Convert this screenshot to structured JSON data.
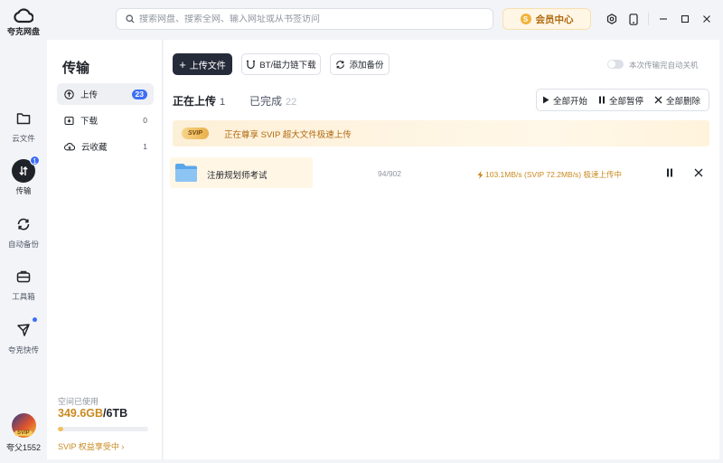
{
  "app": {
    "name": "夸克网盘"
  },
  "rail": {
    "items": [
      {
        "label": "云文件",
        "icon": "folder-icon"
      },
      {
        "label": "传输",
        "icon": "transfer-icon",
        "badge": "1"
      },
      {
        "label": "自动备份",
        "icon": "backup-icon"
      },
      {
        "label": "工具箱",
        "icon": "toolbox-icon"
      },
      {
        "label": "夸克快传",
        "icon": "send-icon"
      }
    ],
    "user": {
      "name": "夸父1552",
      "badge": "SVIP"
    }
  },
  "topbar": {
    "search_placeholder": "搜索网盘、搜索全网、输入网址或从书签访问",
    "vip_label": "会员中心",
    "vip_coin": "S",
    "icons": [
      "settings-icon",
      "phone-icon",
      "minimize-icon",
      "maximize-icon",
      "close-icon"
    ]
  },
  "transfer": {
    "title": "传输",
    "items": [
      {
        "label": "上传",
        "count": "23",
        "icon": "upload-icon"
      },
      {
        "label": "下载",
        "count": "0",
        "icon": "download-icon"
      },
      {
        "label": "云收藏",
        "count": "1",
        "icon": "cloud-icon"
      }
    ],
    "storage": {
      "label": "空间已使用",
      "used": "349.6GB",
      "total": "/6TB",
      "used_fraction": 0.057,
      "link": "SVIP 权益享受中 ›"
    }
  },
  "main": {
    "upload_btn": "上传文件",
    "bt_btn": "BT/磁力链下载",
    "backup_btn": "添加备份",
    "auto_shutdown": "本次传输完自动关机",
    "tabs": [
      {
        "label": "正在上传",
        "count": "1"
      },
      {
        "label": "已完成",
        "count": "22"
      }
    ],
    "actions": [
      "全部开始",
      "全部暂停",
      "全部删除"
    ],
    "banner": {
      "tag": "SVIP",
      "text": "正在尊享 SVIP 超大文件极速上传"
    },
    "rows": [
      {
        "name": "注册规划师考试",
        "progress": "94/902",
        "speed": "103.1MB/s (SVIP 72.2MB/s) 极速上传中"
      }
    ]
  },
  "colors": {
    "accent": "#3e6ef5",
    "gold": "#c98a1f",
    "dark": "#262b3a"
  }
}
